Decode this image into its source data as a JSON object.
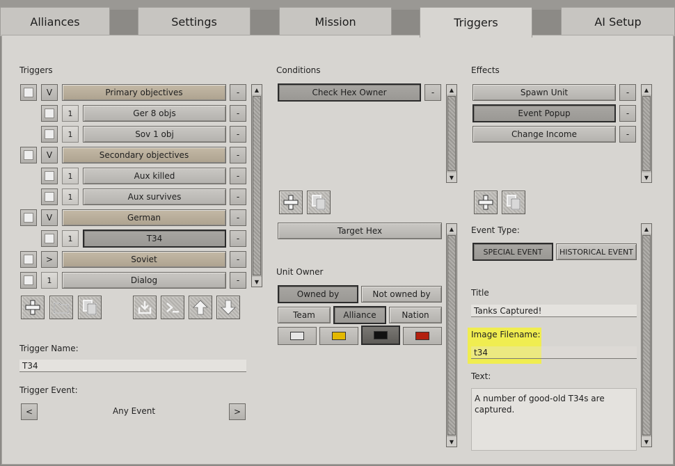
{
  "tabs": [
    {
      "label": "Alliances",
      "active": false
    },
    {
      "label": "Settings",
      "active": false
    },
    {
      "label": "Mission",
      "active": false
    },
    {
      "label": "Triggers",
      "active": true
    },
    {
      "label": "AI Setup",
      "active": false
    }
  ],
  "triggers": {
    "title": "Triggers",
    "items": [
      {
        "toggle": "V",
        "label": "Primary objectives",
        "group": true
      },
      {
        "toggle": "1",
        "label": "Ger 8 objs",
        "group": false
      },
      {
        "toggle": "1",
        "label": "Sov 1 obj",
        "group": false
      },
      {
        "toggle": "V",
        "label": "Secondary objectives",
        "group": true
      },
      {
        "toggle": "1",
        "label": "Aux killed",
        "group": false
      },
      {
        "toggle": "1",
        "label": "Aux survives",
        "group": false
      },
      {
        "toggle": "V",
        "label": "German",
        "group": true
      },
      {
        "toggle": "1",
        "label": "T34",
        "group": false,
        "selected": true
      },
      {
        "toggle": ">",
        "label": "Soviet",
        "group": true
      },
      {
        "toggle": "1",
        "label": "Dialog",
        "group": false
      }
    ],
    "minus_label": "-",
    "name_label": "Trigger Name:",
    "name_value": "T34",
    "event_label": "Trigger Event:",
    "event_value": "Any Event",
    "prev_label": "<",
    "next_label": ">"
  },
  "conditions": {
    "title": "Conditions",
    "items": [
      {
        "label": "Check Hex Owner"
      }
    ],
    "minus_label": "-",
    "target_hex_label": "Target Hex",
    "unit_owner_label": "Unit Owner",
    "owned_by_label": "Owned by",
    "not_owned_by_label": "Not owned by",
    "team_label": "Team",
    "alliance_label": "Alliance",
    "nation_label": "Nation",
    "colors": [
      "#e6e6e6",
      "#e3b800",
      "#111111",
      "#b3200f"
    ]
  },
  "effects": {
    "title": "Effects",
    "items": [
      {
        "label": "Spawn Unit"
      },
      {
        "label": "Event Popup"
      },
      {
        "label": "Change Income"
      }
    ],
    "minus_label": "-",
    "event_type_label": "Event Type:",
    "special_event_label": "SPECIAL EVENT",
    "historical_event_label": "HISTORICAL EVENT",
    "title_label": "Title",
    "title_value": "Tanks Captured!",
    "image_label": "Image Filename:",
    "image_value": "t34",
    "text_label": "Text:",
    "text_value": "A number of good-old T34s are captured."
  },
  "icons": {
    "add": "plus-icon",
    "folder": "folder-icon",
    "copy": "copy-icon",
    "import": "import-icon",
    "script": "script-icon",
    "up": "arrow-up-icon",
    "down": "arrow-down-icon"
  }
}
